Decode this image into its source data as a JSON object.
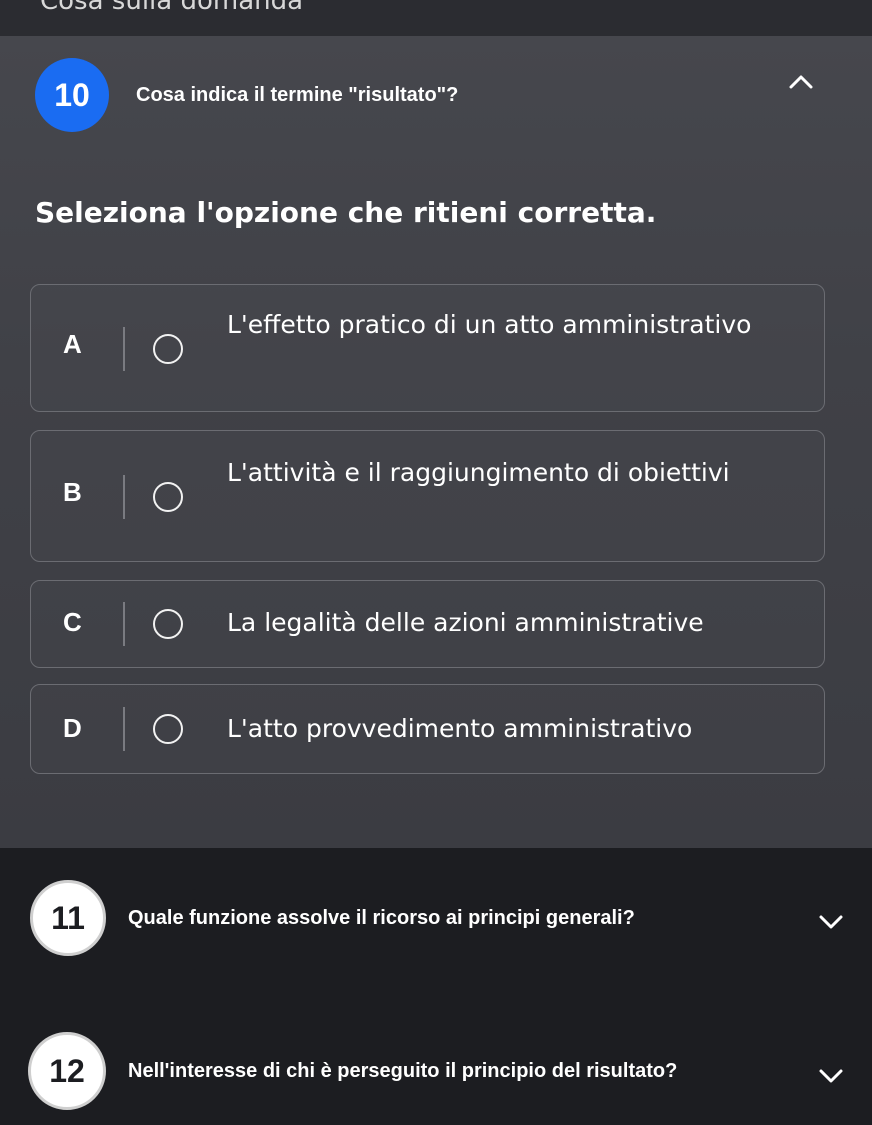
{
  "top_strip": {
    "text": "Cosa sulla domanda"
  },
  "questions": [
    {
      "number": "10",
      "title": "Cosa indica il termine \"risultato\"?",
      "expanded": true,
      "chevron": "chevron-up-icon",
      "instruction": "Seleziona l'opzione che ritieni corretta.",
      "options": [
        {
          "letter": "A",
          "text": "L'effetto pratico di un atto amministrativo"
        },
        {
          "letter": "B",
          "text": "L'attività e il raggiungimento di obiettivi"
        },
        {
          "letter": "C",
          "text": "La legalità delle azioni amministrative"
        },
        {
          "letter": "D",
          "text": "L'atto provvedimento amministrativo"
        }
      ]
    },
    {
      "number": "11",
      "title": "Quale funzione assolve il ricorso ai principi generali?",
      "expanded": false,
      "chevron": "chevron-down-icon"
    },
    {
      "number": "12",
      "title": "Nell'interesse di chi è perseguito il principio del risultato?",
      "expanded": false,
      "chevron": "chevron-down-icon"
    }
  ],
  "colors": {
    "active_badge": "#1a6cf2",
    "panel_bg": "#404147",
    "page_bg": "#1c1d21",
    "option_border": "#6b6c72"
  }
}
